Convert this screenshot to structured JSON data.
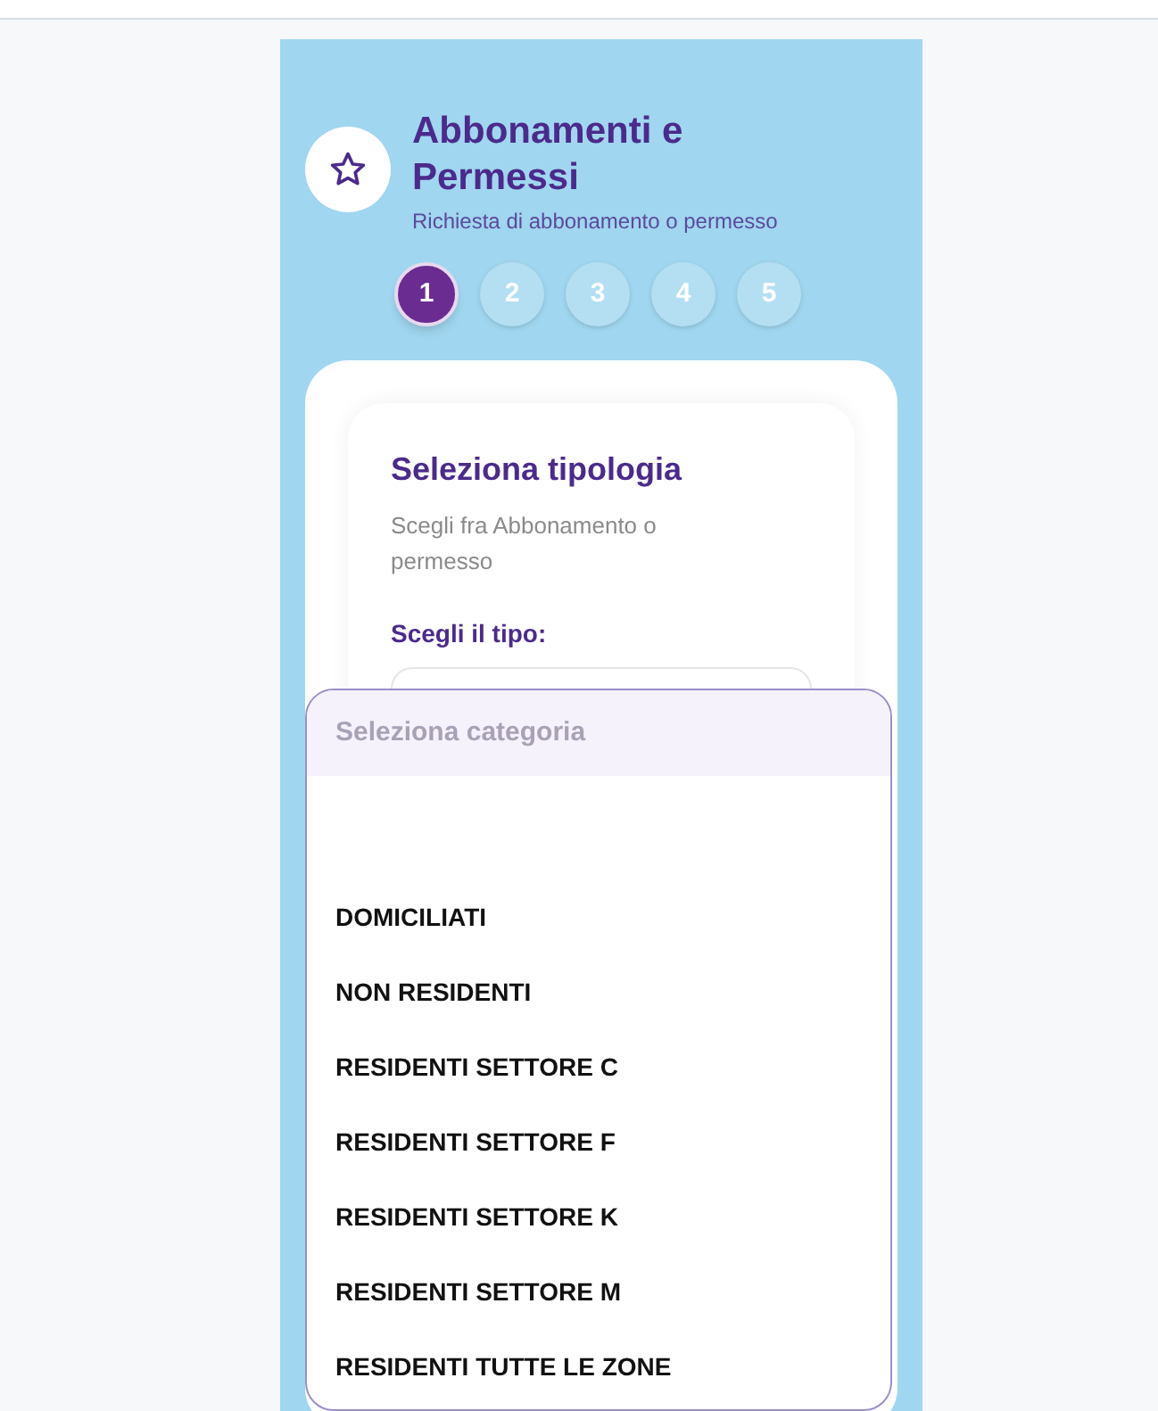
{
  "header": {
    "title": "Abbonamenti e Permessi",
    "subtitle": "Richiesta di abbonamento o permesso"
  },
  "steps": [
    {
      "label": "1",
      "selected": true
    },
    {
      "label": "2",
      "selected": false
    },
    {
      "label": "3",
      "selected": false
    },
    {
      "label": "4",
      "selected": false
    },
    {
      "label": "5",
      "selected": false
    }
  ],
  "card": {
    "title": "Seleziona tipologia",
    "description": "Scegli fra Abbonamento o permesso",
    "field_label": "Scegli il tipo:"
  },
  "dropdown": {
    "placeholder": "Seleziona categoria",
    "options": [
      "DOMICILIATI",
      "NON RESIDENTI",
      "RESIDENTI SETTORE C",
      "RESIDENTI SETTORE F",
      "RESIDENTI SETTORE K",
      "RESIDENTI SETTORE M",
      "RESIDENTI TUTTE LE ZONE"
    ]
  }
}
